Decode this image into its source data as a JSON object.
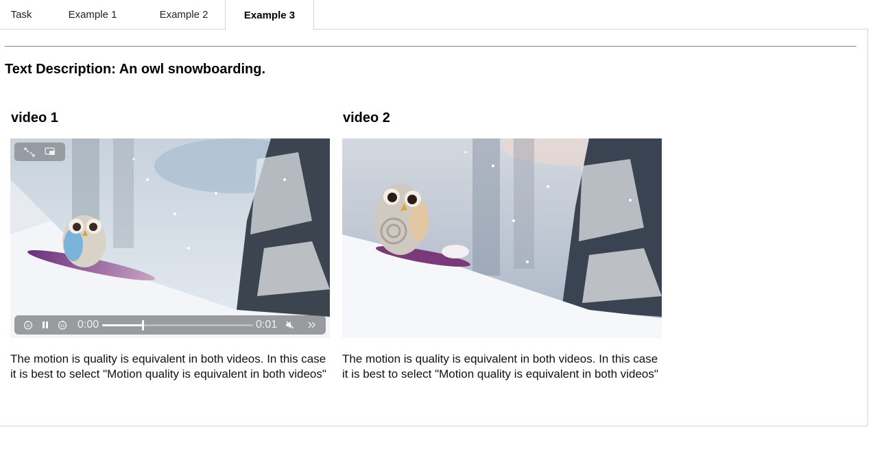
{
  "tabs": [
    {
      "label": "Task",
      "active": false
    },
    {
      "label": "Example 1",
      "active": false
    },
    {
      "label": "Example 2",
      "active": false
    },
    {
      "label": "Example 3",
      "active": true
    }
  ],
  "description": "Text Description: An owl snowboarding.",
  "videos": [
    {
      "title": "video 1",
      "current_time": "0:00",
      "duration": "0:01",
      "progress": 0.27,
      "playing": true,
      "muted": true,
      "caption": "The motion is quality is equivalent in both videos. In this case it is best to select \"Motion quality is equivalent in both videos\""
    },
    {
      "title": "video 2",
      "caption": "The motion is quality is equivalent in both videos. In this case it is best to select \"Motion quality is equivalent in both videos\""
    }
  ],
  "icons": {
    "fullscreen": "fullscreen-icon",
    "pip": "picture-in-picture-icon",
    "rewind": "rewind-15-icon",
    "pause": "pause-icon",
    "forward": "forward-15-icon",
    "mute": "speaker-muted-icon",
    "more": "chevron-double-right-icon"
  },
  "colors": {
    "border": "#d4d4d4",
    "rule": "#808080"
  }
}
